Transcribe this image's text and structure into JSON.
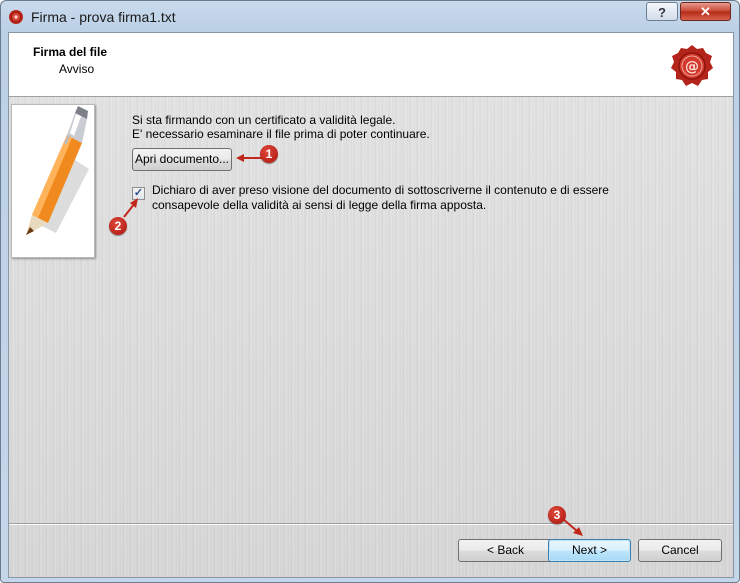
{
  "window": {
    "title": "Firma - prova firma1.txt",
    "help_label": "?",
    "close_label": "✕"
  },
  "header": {
    "title": "Firma del file",
    "subtitle": "Avviso"
  },
  "main": {
    "line1": "Si sta firmando con un certificato a validità legale.",
    "line2": "E' necessario esaminare il file prima di poter continuare.",
    "open_button": "Apri documento...",
    "checkbox_checked": true,
    "checkbox_label": "Dichiaro di aver preso visione del documento di sottoscriverne il contenuto e di essere consapevole della validità ai sensi di legge della firma apposta."
  },
  "footer": {
    "back": "< Back",
    "next": "Next >",
    "cancel": "Cancel"
  },
  "annotations": [
    "1",
    "2",
    "3"
  ],
  "icons": {
    "app": "wax-seal-icon",
    "seal": "wax-seal-at-icon",
    "pen": "pen-icon"
  },
  "colors": {
    "accent": "#c0271b",
    "default_button_border": "#3c7fb1"
  }
}
